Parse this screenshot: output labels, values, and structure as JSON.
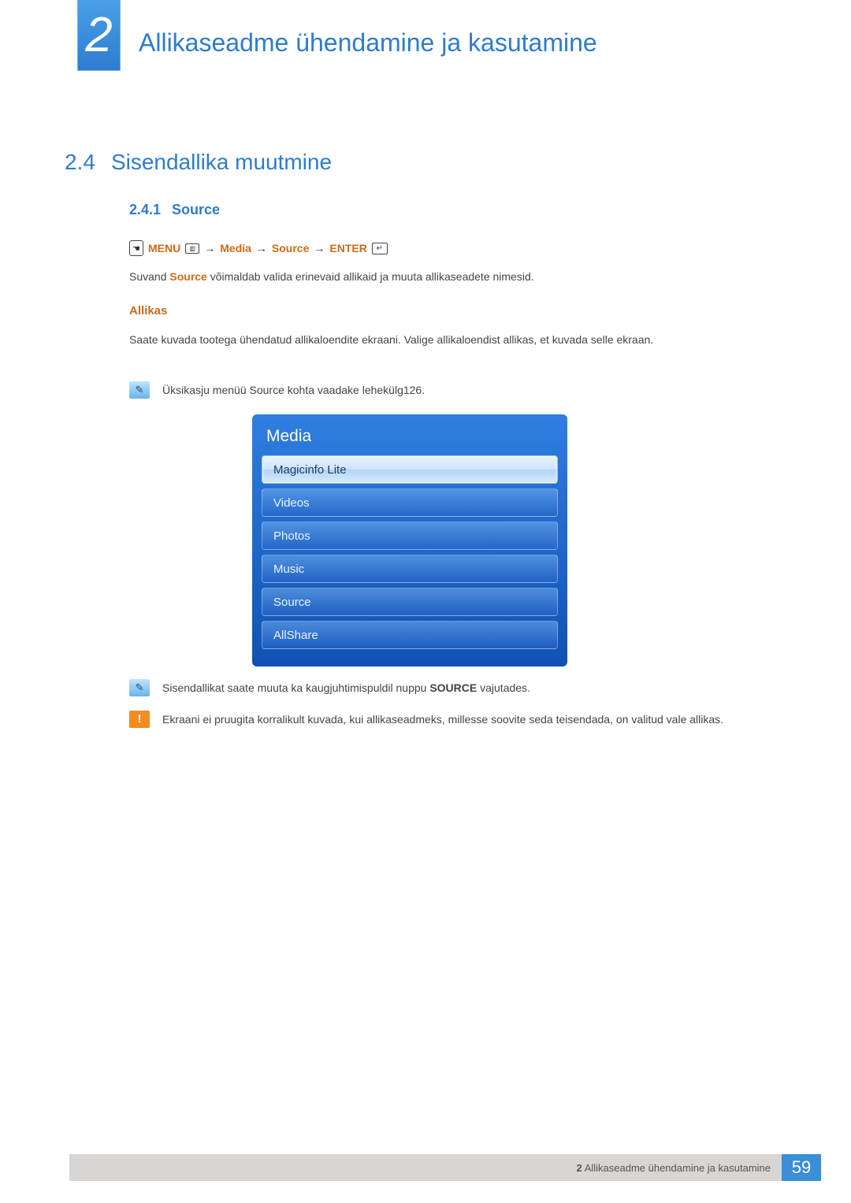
{
  "chapter": {
    "number": "2",
    "title": "Allikaseadme ühendamine ja kasutamine"
  },
  "section": {
    "number": "2.4",
    "title": "Sisendallika muutmine"
  },
  "subsection": {
    "number": "2.4.1",
    "title": "Source"
  },
  "nav": {
    "menu": "MENU",
    "arrow": "→",
    "step1": "Media",
    "step2": "Source",
    "enter": "ENTER"
  },
  "paragraphs": {
    "p1_a": "Suvand ",
    "p1_kw": "Source",
    "p1_b": " võimaldab valida erinevaid allikaid ja muuta allikaseadete nimesid.",
    "h3": "Allikas",
    "p2": "Saate kuvada tootega ühendatud allikaloendite ekraani. Valige allikaloendist allikas, et kuvada selle ekraan."
  },
  "notes": {
    "n1_a": "Üksikasju menüü ",
    "n1_kw": "Source",
    "n1_b": " kohta vaadake lehekülg126.",
    "n2_a": "Sisendallikat saate muuta ka kaugjuhtimispuldil nuppu ",
    "n2_kw": "SOURCE",
    "n2_b": " vajutades.",
    "n3": "Ekraani ei pruugita korralikult kuvada, kui allikaseadmeks, millesse soovite seda teisendada, on valitud vale allikas."
  },
  "media_menu": {
    "title": "Media",
    "items": [
      {
        "label": "Magicinfo Lite",
        "selected": true
      },
      {
        "label": "Videos",
        "selected": false
      },
      {
        "label": "Photos",
        "selected": false
      },
      {
        "label": "Music",
        "selected": false
      },
      {
        "label": "Source",
        "selected": false
      },
      {
        "label": "AllShare",
        "selected": false
      }
    ]
  },
  "footer": {
    "chapter_ref": "2",
    "text": "Allikaseadme ühendamine ja kasutamine",
    "page": "59"
  }
}
